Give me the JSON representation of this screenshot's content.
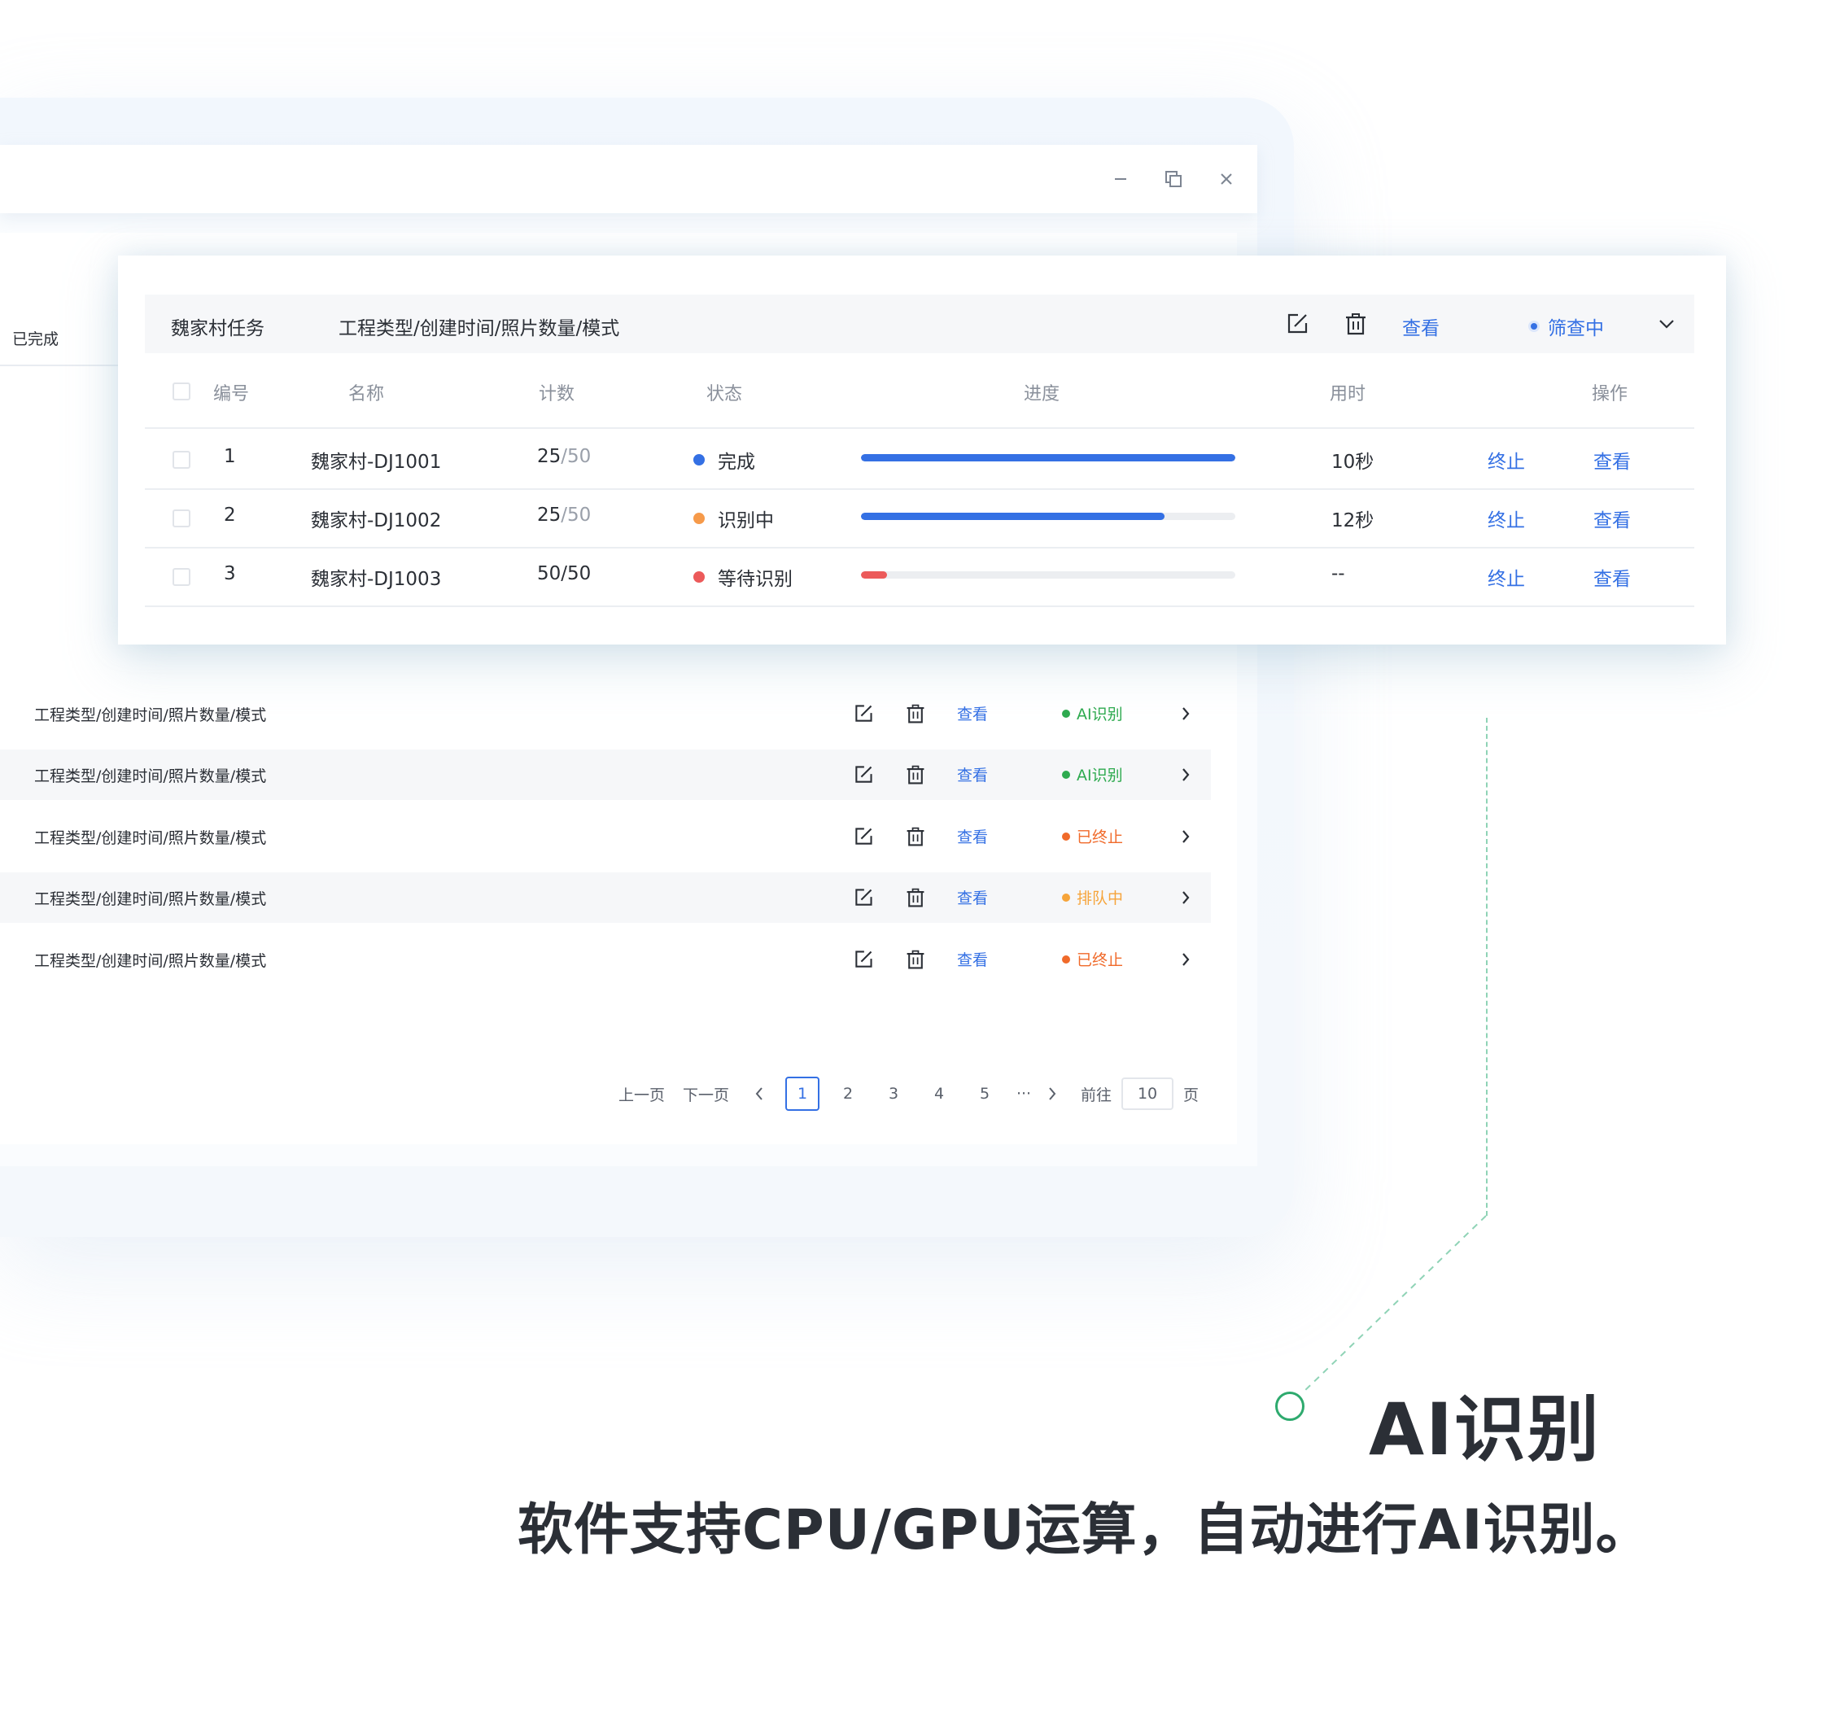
{
  "window": {
    "minimize_icon": "minimize-icon",
    "restore_icon": "restore-icon",
    "close_icon": "close-icon"
  },
  "sidebar": {
    "completed_label": "已完成"
  },
  "task_list": [
    {
      "desc": "工程类型/创建时间/照片数量/模式",
      "view": "查看",
      "status": "AI识别",
      "status_color": "#2eaa4f"
    },
    {
      "desc": "工程类型/创建时间/照片数量/模式",
      "view": "查看",
      "status": "AI识别",
      "status_color": "#2eaa4f"
    },
    {
      "desc": "工程类型/创建时间/照片数量/模式",
      "view": "查看",
      "status": "已终止",
      "status_color": "#f06a2a"
    },
    {
      "desc": "工程类型/创建时间/照片数量/模式",
      "view": "查看",
      "status": "排队中",
      "status_color": "#f6a43a"
    },
    {
      "desc": "工程类型/创建时间/照片数量/模式",
      "view": "查看",
      "status": "已终止",
      "status_color": "#f06a2a"
    }
  ],
  "pagination": {
    "prev": "上一页",
    "next": "下一页",
    "pages": [
      "1",
      "2",
      "3",
      "4",
      "5"
    ],
    "current": "1",
    "ellipsis": "···",
    "goto": "前往",
    "goto_value": "10",
    "page_suffix": "页"
  },
  "card": {
    "title": "魏家村任务",
    "desc": "工程类型/创建时间/照片数量/模式",
    "view": "查看",
    "status": "筛查中",
    "status_color": "#3470e4",
    "columns": [
      "编号",
      "名称",
      "计数",
      "状态",
      "进度",
      "用时",
      "操作"
    ],
    "rows": [
      {
        "no": "1",
        "name": "魏家村-DJ1001",
        "count_done": "25",
        "count_total": "/50",
        "status": "完成",
        "status_color": "#3470e4",
        "progress": 1.0,
        "progress_color": "#3470e4",
        "time": "10秒",
        "action1": "终止",
        "action2": "查看"
      },
      {
        "no": "2",
        "name": "魏家村-DJ1002",
        "count_done": "25",
        "count_total": "/50",
        "status": "识别中",
        "status_color": "#f69a4a",
        "progress": 0.81,
        "progress_color": "#3470e4",
        "time": "12秒",
        "action1": "终止",
        "action2": "查看"
      },
      {
        "no": "3",
        "name": "魏家村-DJ1003",
        "count_done": "50",
        "count_total": "/50",
        "status": "等待识别",
        "status_color": "#ec5a5a",
        "progress": 0.07,
        "progress_color": "#ec5a5a",
        "time": "--",
        "action1": "终止",
        "action2": "查看"
      }
    ]
  },
  "callout": {
    "title": "AI识别",
    "description": "软件支持CPU/GPU运算，自动进行AI识别。",
    "accent_color": "#2eaa6e"
  },
  "colors": {
    "primary": "#3470e4",
    "text": "#2b2f36",
    "muted": "#8a909b"
  }
}
